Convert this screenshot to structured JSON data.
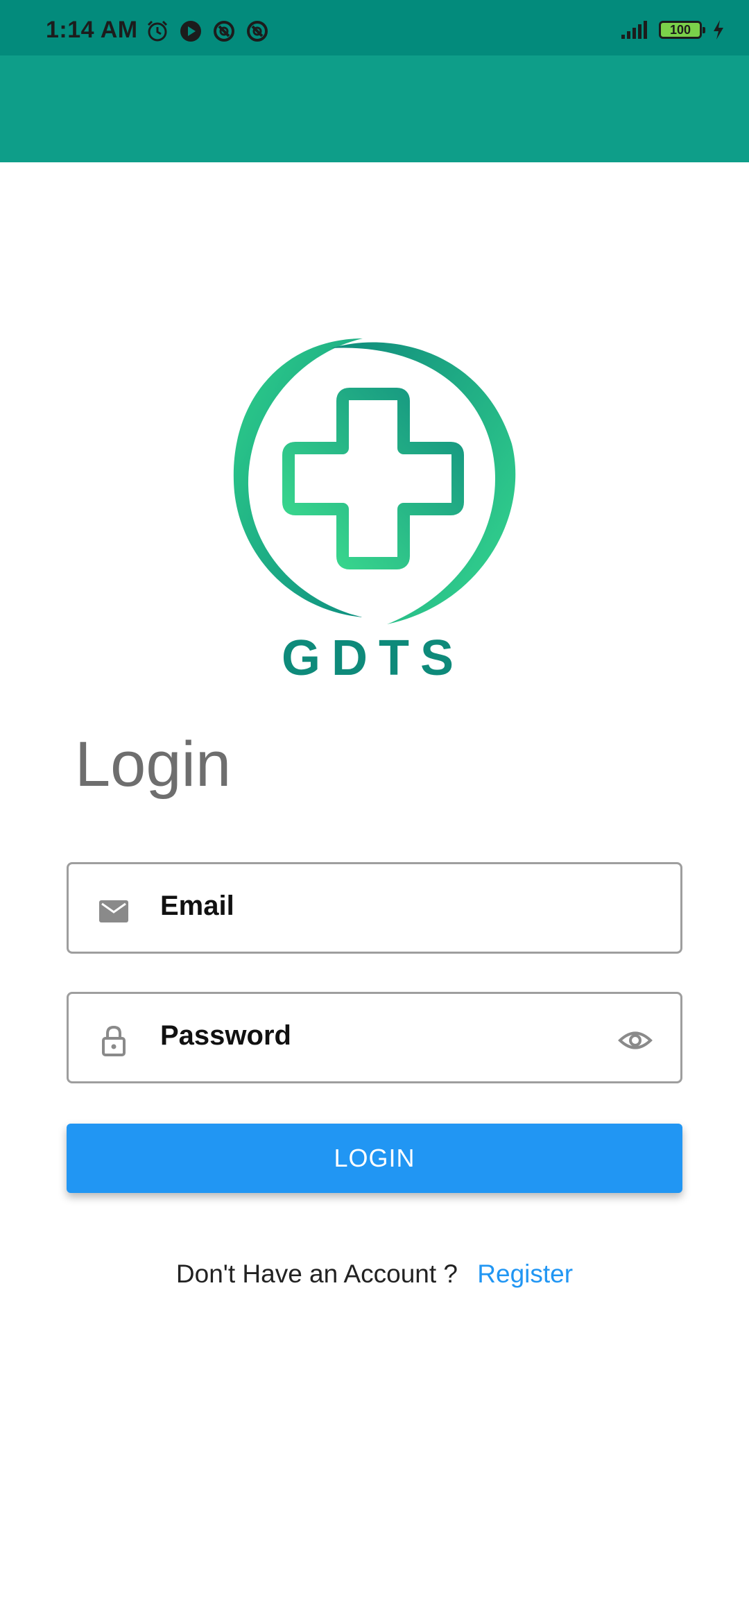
{
  "status_bar": {
    "time": "1:14 AM",
    "battery": "100",
    "icons_left": [
      "alarm-icon",
      "play-icon",
      "sync-icon",
      "sync-icon"
    ],
    "icons_right": [
      "signal-icon",
      "battery-icon",
      "charging-icon"
    ]
  },
  "app_bar": {
    "color": "#0e9e89"
  },
  "logo": {
    "brand_text": "GDTS",
    "icon": "medical-cross-logo"
  },
  "form": {
    "title": "Login",
    "email_label": "Email",
    "password_label": "Password",
    "login_button": "LOGIN"
  },
  "footer": {
    "prompt": "Don't Have an Account ?",
    "register_link": "Register"
  },
  "colors": {
    "status_bar": "#038b7c",
    "accent": "#2196f3",
    "brand": "#0e8a7a"
  }
}
